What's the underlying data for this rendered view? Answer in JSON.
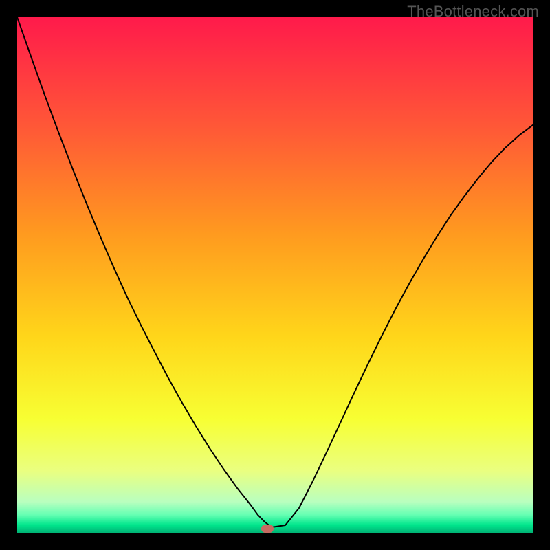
{
  "watermark": "TheBottleneck.com",
  "chart_data": {
    "type": "line",
    "title": "",
    "xlabel": "",
    "ylabel": "",
    "xlim": [
      0,
      100
    ],
    "ylim": [
      0,
      100
    ],
    "series": [
      {
        "name": "bottleneck-curve",
        "x": [
          0,
          2.67,
          5.33,
          8.0,
          10.67,
          13.33,
          16.0,
          18.67,
          21.33,
          24.0,
          26.67,
          29.33,
          32.0,
          34.67,
          37.33,
          40.0,
          42.67,
          45.33,
          46.67,
          48.0,
          49.33,
          52.0,
          54.67,
          57.33,
          60.0,
          62.67,
          65.33,
          68.0,
          70.67,
          73.33,
          76.0,
          78.67,
          81.33,
          84.0,
          86.67,
          89.33,
          92.0,
          94.67,
          97.33,
          100.0
        ],
        "y": [
          100.0,
          92.4,
          84.93,
          77.73,
          70.8,
          64.13,
          57.73,
          51.6,
          45.73,
          40.27,
          35.07,
          30.0,
          25.2,
          20.67,
          16.4,
          12.4,
          8.67,
          5.33,
          3.47,
          2.13,
          1.07,
          1.47,
          4.8,
          10.0,
          15.6,
          21.33,
          27.07,
          32.67,
          38.13,
          43.33,
          48.27,
          52.93,
          57.33,
          61.47,
          65.2,
          68.67,
          71.87,
          74.67,
          77.07,
          79.07
        ]
      }
    ],
    "marker": {
      "x": 48.5,
      "y": 0.8
    },
    "gradient_stops": [
      {
        "pos": 0.0,
        "color": "#ff1a4b"
      },
      {
        "pos": 0.22,
        "color": "#ff5a36"
      },
      {
        "pos": 0.42,
        "color": "#ff9a1f"
      },
      {
        "pos": 0.62,
        "color": "#ffd61a"
      },
      {
        "pos": 0.78,
        "color": "#f7ff33"
      },
      {
        "pos": 0.88,
        "color": "#eaff80"
      },
      {
        "pos": 0.94,
        "color": "#b9ffbf"
      },
      {
        "pos": 0.965,
        "color": "#66ffb3"
      },
      {
        "pos": 0.985,
        "color": "#00e68c"
      },
      {
        "pos": 1.0,
        "color": "#00b374"
      }
    ]
  }
}
